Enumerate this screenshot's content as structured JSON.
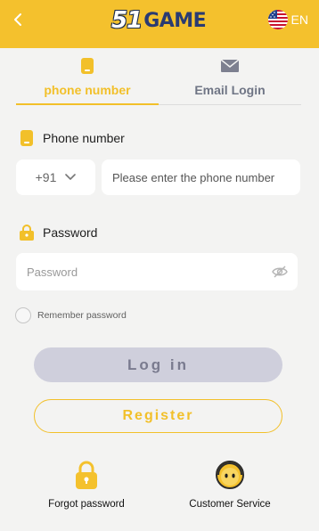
{
  "header": {
    "logo_mark": "51",
    "logo_text": "GAME",
    "language": "EN",
    "colors": {
      "background": "#f4c12d",
      "logo_text": "#2a3b72"
    }
  },
  "tabs": [
    {
      "label": "phone number",
      "icon": "phone-icon",
      "active": true
    },
    {
      "label": "Email Login",
      "icon": "mail-icon",
      "active": false
    }
  ],
  "phone": {
    "label": "Phone number",
    "country_code": "+91",
    "placeholder": "Please enter the phone number"
  },
  "password": {
    "label": "Password",
    "placeholder": "Password"
  },
  "remember": {
    "label": "Remember password",
    "checked": false
  },
  "buttons": {
    "login": "Log in",
    "register": "Register"
  },
  "links": {
    "forgot": {
      "label": "Forgot password",
      "icon": "lock-icon"
    },
    "service": {
      "label": "Customer Service",
      "icon": "customer-service-icon"
    }
  },
  "accent_color": "#f2c02a"
}
